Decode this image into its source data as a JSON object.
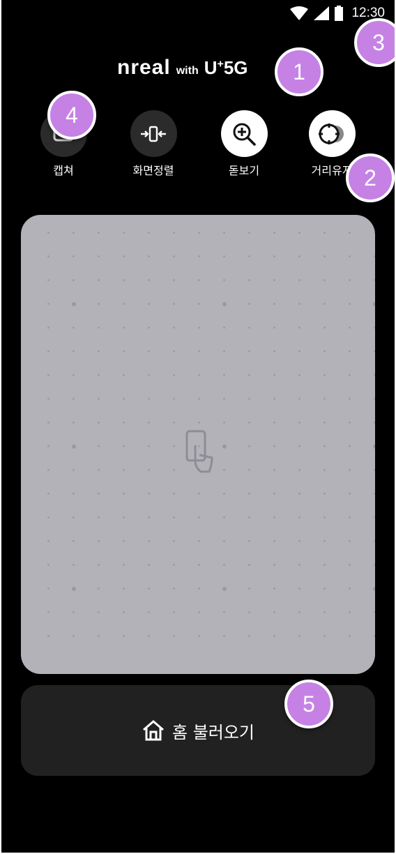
{
  "status_bar": {
    "time": "12:30"
  },
  "header": {
    "brand": "nreal",
    "with": "with",
    "partner": "U",
    "partner_sup": "+",
    "partner_suffix": "5G"
  },
  "tools": [
    {
      "label": "캡쳐",
      "icon": "capture-icon"
    },
    {
      "label": "화면정렬",
      "icon": "align-screen-icon"
    },
    {
      "label": "돋보기",
      "icon": "magnifier-icon"
    },
    {
      "label": "거리유지",
      "icon": "distance-keep-icon"
    }
  ],
  "home_button": {
    "label": "홈 불러오기",
    "icon": "home-icon"
  },
  "badges": [
    "1",
    "2",
    "3",
    "4",
    "5"
  ],
  "colors": {
    "background": "#000000",
    "panel": "#b4b2b9",
    "home_button": "#212121",
    "badge": "#c582e4"
  }
}
